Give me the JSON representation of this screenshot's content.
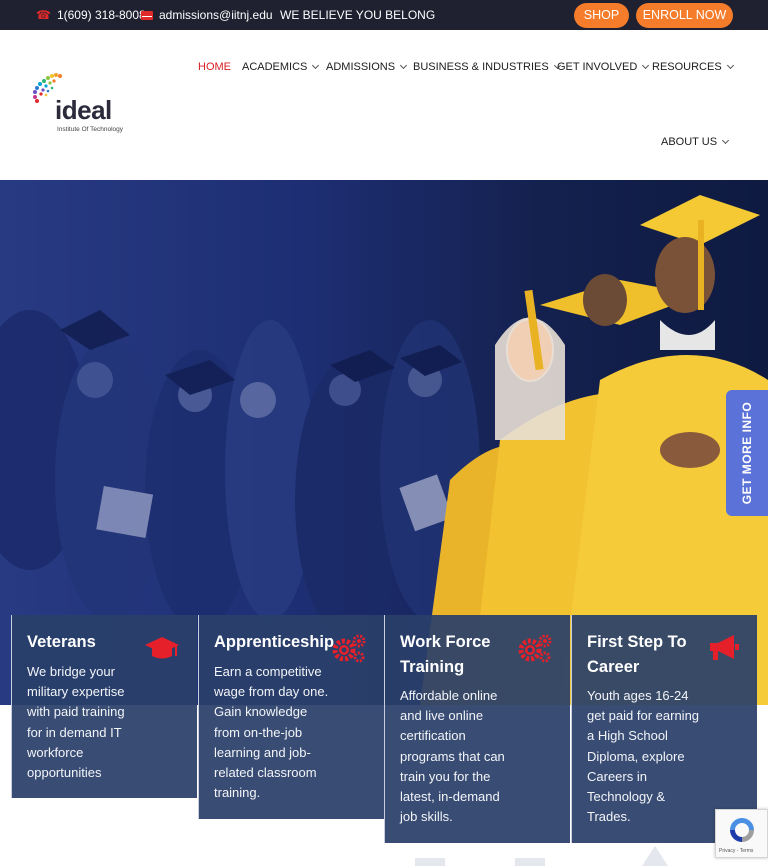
{
  "topbar": {
    "phone": "1(609) 318-8008",
    "email": "admissions@iitnj.edu",
    "slogan": "WE BELIEVE YOU BELONG",
    "shop_label": "SHOP",
    "enroll_label": "ENROLL NOW"
  },
  "logo": {
    "word": "ideal",
    "tagline": "Institute Of Technology"
  },
  "nav": {
    "items": [
      {
        "label": "HOME",
        "active": true
      },
      {
        "label": "ACADEMICS",
        "has_dropdown": true
      },
      {
        "label": "ADMISSIONS",
        "has_dropdown": true
      },
      {
        "label": "BUSINESS & INDUSTRIES",
        "has_dropdown": true
      },
      {
        "label": "GET INVOLVED",
        "has_dropdown": true
      },
      {
        "label": "RESOURCES",
        "has_dropdown": true
      },
      {
        "label": "ABOUT US",
        "has_dropdown": true
      }
    ]
  },
  "side_tab": {
    "label": "GET MORE INFO"
  },
  "cards": [
    {
      "title": "Veterans",
      "icon": "graduation-cap-icon",
      "lines": [
        "We bridge your",
        "military expertise",
        "with paid training",
        "for in demand IT",
        "workforce",
        "opportunities"
      ]
    },
    {
      "title": "Apprenticeship",
      "icon": "gears-icon",
      "lines": [
        "Earn a competitive",
        "wage from day one.",
        "Gain knowledge",
        "from on-the-job",
        "learning and job-",
        "related classroom",
        "training."
      ]
    },
    {
      "title_lines": [
        "Work Force",
        "Training"
      ],
      "icon": "gears-icon",
      "lines": [
        "Affordable online",
        "and live online",
        "certification",
        "programs that can",
        "train you for the",
        "latest, in-demand",
        "job skills."
      ]
    },
    {
      "title_lines": [
        "First Step To",
        "Career"
      ],
      "icon": "megaphone-icon",
      "lines": [
        "Youth ages 16-24",
        "get paid for earning",
        "a High School",
        "Diploma, explore",
        "Careers in",
        "Technology &",
        "Trades."
      ]
    }
  ],
  "recaptcha": {
    "text": "Privacy - Terms"
  },
  "colors": {
    "topbar_bg": "#1f2030",
    "accent_orange": "#f47c2b",
    "active_red": "#d81f26",
    "card_bg": "#2a4069",
    "side_tab": "#5b73d8",
    "gown_gold": "#f2c230"
  }
}
